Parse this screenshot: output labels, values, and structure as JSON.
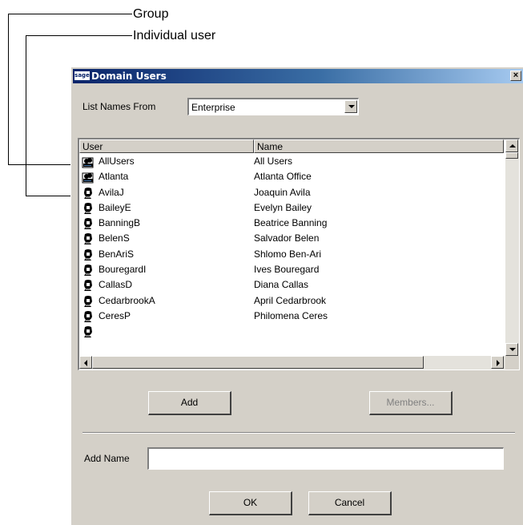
{
  "callouts": {
    "group": "Group",
    "individual": "Individual user"
  },
  "dialog": {
    "logo": "sage",
    "title": "Domain Users",
    "close": "×",
    "list_names_label": "List Names From",
    "list_names_value": "Enterprise",
    "columns": {
      "user": "User",
      "name": "Name"
    },
    "rows": [
      {
        "user": "AllUsers",
        "name": "All Users",
        "icon": "group-icon"
      },
      {
        "user": "Atlanta",
        "name": "Atlanta Office",
        "icon": "group-icon"
      },
      {
        "user": "AvilaJ",
        "name": "Joaquin Avila",
        "icon": "user-icon"
      },
      {
        "user": "BaileyE",
        "name": "Evelyn Bailey",
        "icon": "user-icon"
      },
      {
        "user": "BanningB",
        "name": "Beatrice Banning",
        "icon": "user-icon"
      },
      {
        "user": "BelenS",
        "name": "Salvador Belen",
        "icon": "user-icon"
      },
      {
        "user": "BenAriS",
        "name": "Shlomo Ben-Ari",
        "icon": "user-icon"
      },
      {
        "user": "BouregardI",
        "name": "Ives Bouregard",
        "icon": "user-icon"
      },
      {
        "user": "CallasD",
        "name": "Diana Callas",
        "icon": "user-icon"
      },
      {
        "user": "CedarbrookA",
        "name": "April Cedarbrook",
        "icon": "user-icon"
      },
      {
        "user": "CeresP",
        "name": "Philomena Ceres",
        "icon": "user-icon"
      },
      {
        "user": "",
        "name": "",
        "icon": "user-icon"
      }
    ],
    "buttons": {
      "add": "Add",
      "members": "Members...",
      "ok": "OK",
      "cancel": "Cancel"
    },
    "add_name_label": "Add Name",
    "add_name_value": ""
  }
}
